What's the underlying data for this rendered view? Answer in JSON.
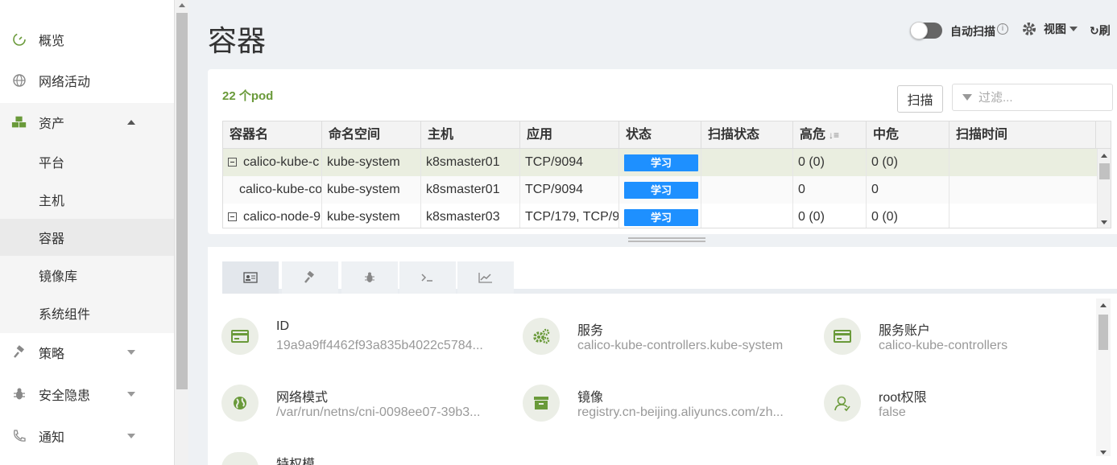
{
  "sidebar": {
    "items": [
      {
        "label": "概览",
        "icon": "dashboard-icon"
      },
      {
        "label": "网络活动",
        "icon": "globe-icon"
      },
      {
        "label": "资产",
        "icon": "cubes-icon"
      },
      {
        "label": "策略",
        "icon": "gavel-icon"
      },
      {
        "label": "安全隐患",
        "icon": "bug-icon"
      },
      {
        "label": "通知",
        "icon": "phone-icon"
      }
    ],
    "asset_sub": [
      "平台",
      "主机",
      "容器",
      "镜像库",
      "系统组件"
    ]
  },
  "header": {
    "title": "容器",
    "auto_scan": "自动扫描",
    "info": "i",
    "view": "视图",
    "refresh": "刷"
  },
  "toolbar": {
    "pod_count": "22 个pod",
    "scan": "扫描",
    "filter_placeholder": "过滤..."
  },
  "table": {
    "columns": [
      "容器名",
      "命名空间",
      "主机",
      "应用",
      "状态",
      "扫描状态",
      "高危",
      "中危",
      "扫描时间"
    ],
    "rows": [
      {
        "name": "calico-kube-c",
        "ns": "kube-system",
        "host": "k8smaster01",
        "app": "TCP/9094",
        "status": "学习",
        "scan": "",
        "high": "0 (0)",
        "mid": "0 (0)",
        "time": "",
        "expander": true
      },
      {
        "name": "calico-kube-co",
        "ns": "kube-system",
        "host": "k8smaster01",
        "app": "TCP/9094",
        "status": "学习",
        "scan": "",
        "high": "0",
        "mid": "0",
        "time": "",
        "expander": false
      },
      {
        "name": "calico-node-9",
        "ns": "kube-system",
        "host": "k8smaster03",
        "app": "TCP/179, TCP/9",
        "status": "学习",
        "scan": "",
        "high": "0 (0)",
        "mid": "0 (0)",
        "time": "",
        "expander": true
      }
    ]
  },
  "tabs": [
    "id-card-icon",
    "gavel-icon",
    "bug-icon",
    "terminal-icon",
    "chart-icon"
  ],
  "details": [
    {
      "key": "ID",
      "value": "19a9a9ff4462f93a835b4022c5784...",
      "icon": "card-icon"
    },
    {
      "key": "服务",
      "value": "calico-kube-controllers.kube-system",
      "icon": "cogs-icon"
    },
    {
      "key": "服务账户",
      "value": "calico-kube-controllers",
      "icon": "card-icon"
    },
    {
      "key": "网络模式",
      "value": "/var/run/netns/cni-0098ee07-39b3...",
      "icon": "globe-icon"
    },
    {
      "key": "镜像",
      "value": "registry.cn-beijing.aliyuncs.com/zh...",
      "icon": "archive-icon"
    },
    {
      "key": "root权限",
      "value": "false",
      "icon": "user-icon"
    }
  ],
  "partial_label": "特权模",
  "colors": {
    "accent_green": "#6a9a3a",
    "badge_blue": "#1e90ff",
    "selected_row": "#eaeee0"
  }
}
